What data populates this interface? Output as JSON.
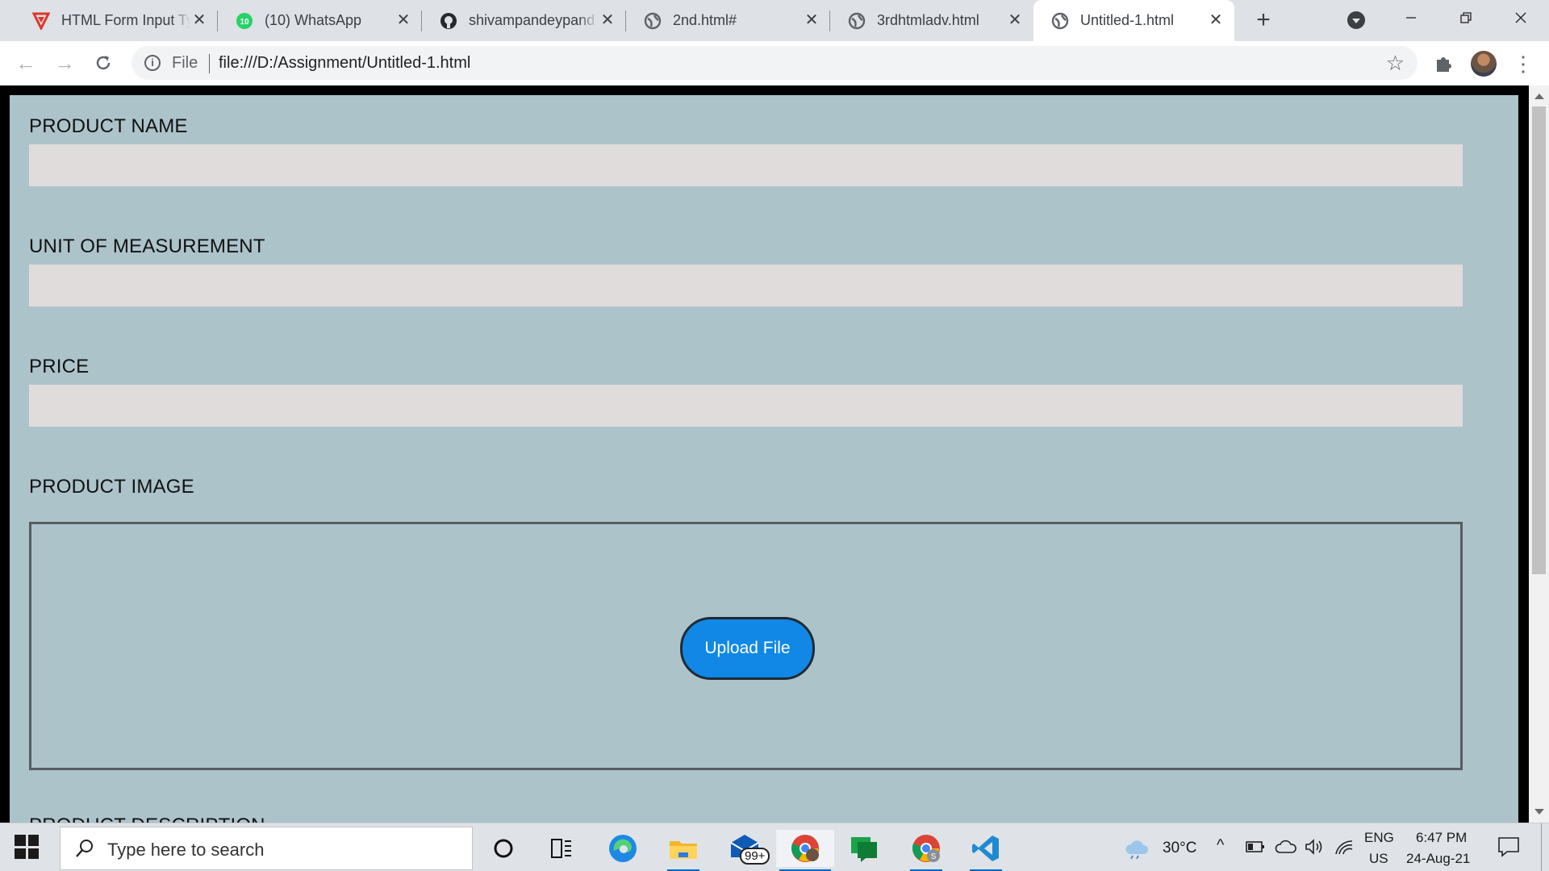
{
  "browser": {
    "tabs": [
      {
        "title": "HTML Form Input Ty",
        "icon": "tutorial-logo-icon"
      },
      {
        "title": "(10) WhatsApp",
        "icon": "whatsapp-icon",
        "badge": "10"
      },
      {
        "title": "shivampandeypand",
        "icon": "github-icon"
      },
      {
        "title": "2nd.html#",
        "icon": "globe-icon"
      },
      {
        "title": "3rdhtmladv.html",
        "icon": "globe-icon"
      },
      {
        "title": "Untitled-1.html",
        "icon": "globe-icon",
        "active": true
      }
    ],
    "address": {
      "scheme_label": "File",
      "url": "file:///D:/Assignment/Untitled-1.html"
    }
  },
  "form": {
    "product_name_label": "PRODUCT NAME",
    "unit_label": "UNIT OF MEASUREMENT",
    "price_label": "PRICE",
    "image_label": "PRODUCT IMAGE",
    "upload_button": "Upload File",
    "description_label": "PRODUCT DESCRIPTION",
    "product_name_value": "",
    "unit_value": "",
    "price_value": ""
  },
  "taskbar": {
    "search_placeholder": "Type here to search",
    "mail_badge": "99+",
    "weather": "30°C",
    "lang_top": "ENG",
    "lang_bottom": "US",
    "time": "6:47 PM",
    "date": "24-Aug-21"
  },
  "colors": {
    "page_background": "#acc3ca",
    "input_background": "#e0dcdc",
    "upload_button": "#1188e5"
  }
}
